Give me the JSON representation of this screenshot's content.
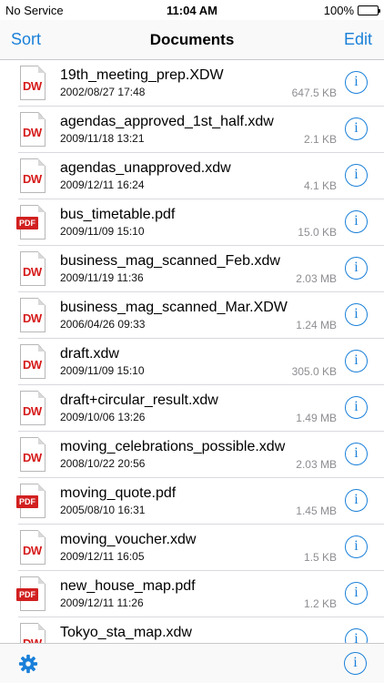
{
  "status": {
    "carrier": "No Service",
    "time": "11:04 AM",
    "battery": "100%",
    "battery_level": 1.0
  },
  "nav": {
    "left": "Sort",
    "title": "Documents",
    "right": "Edit"
  },
  "documents": [
    {
      "name": "19th_meeting_prep.XDW",
      "date": "2002/08/27 17:48",
      "size": "647.5 KB",
      "type": "dw"
    },
    {
      "name": "agendas_approved_1st_half.xdw",
      "date": "2009/11/18 13:21",
      "size": "2.1 KB",
      "type": "dw"
    },
    {
      "name": "agendas_unapproved.xdw",
      "date": "2009/12/11 16:24",
      "size": "4.1 KB",
      "type": "dw"
    },
    {
      "name": "bus_timetable.pdf",
      "date": "2009/11/09 15:10",
      "size": "15.0 KB",
      "type": "pdf"
    },
    {
      "name": "business_mag_scanned_Feb.xdw",
      "date": "2009/11/19 11:36",
      "size": "2.03 MB",
      "type": "dw"
    },
    {
      "name": "business_mag_scanned_Mar.XDW",
      "date": "2006/04/26 09:33",
      "size": "1.24 MB",
      "type": "dw"
    },
    {
      "name": "draft.xdw",
      "date": "2009/11/09 15:10",
      "size": "305.0 KB",
      "type": "dw"
    },
    {
      "name": "draft+circular_result.xdw",
      "date": "2009/10/06 13:26",
      "size": "1.49 MB",
      "type": "dw"
    },
    {
      "name": "moving_celebrations_possible.xdw",
      "date": "2008/10/22 20:56",
      "size": "2.03 MB",
      "type": "dw"
    },
    {
      "name": "moving_quote.pdf",
      "date": "2005/08/10 16:31",
      "size": "1.45 MB",
      "type": "pdf"
    },
    {
      "name": "moving_voucher.xdw",
      "date": "2009/12/11 16:05",
      "size": "1.5 KB",
      "type": "dw"
    },
    {
      "name": "new_house_map.pdf",
      "date": "2009/12/11 11:26",
      "size": "1.2 KB",
      "type": "pdf"
    },
    {
      "name": "Tokyo_sta_map.xdw",
      "date": "",
      "size": "",
      "type": "dw"
    }
  ],
  "icons": {
    "dw_badge": "DW",
    "pdf_badge": "PDF",
    "info": "i",
    "settings": "gear-icon"
  },
  "colors": {
    "accent": "#1a80d9",
    "dw": "#d61a1a",
    "pdf": "#d21f1f"
  }
}
